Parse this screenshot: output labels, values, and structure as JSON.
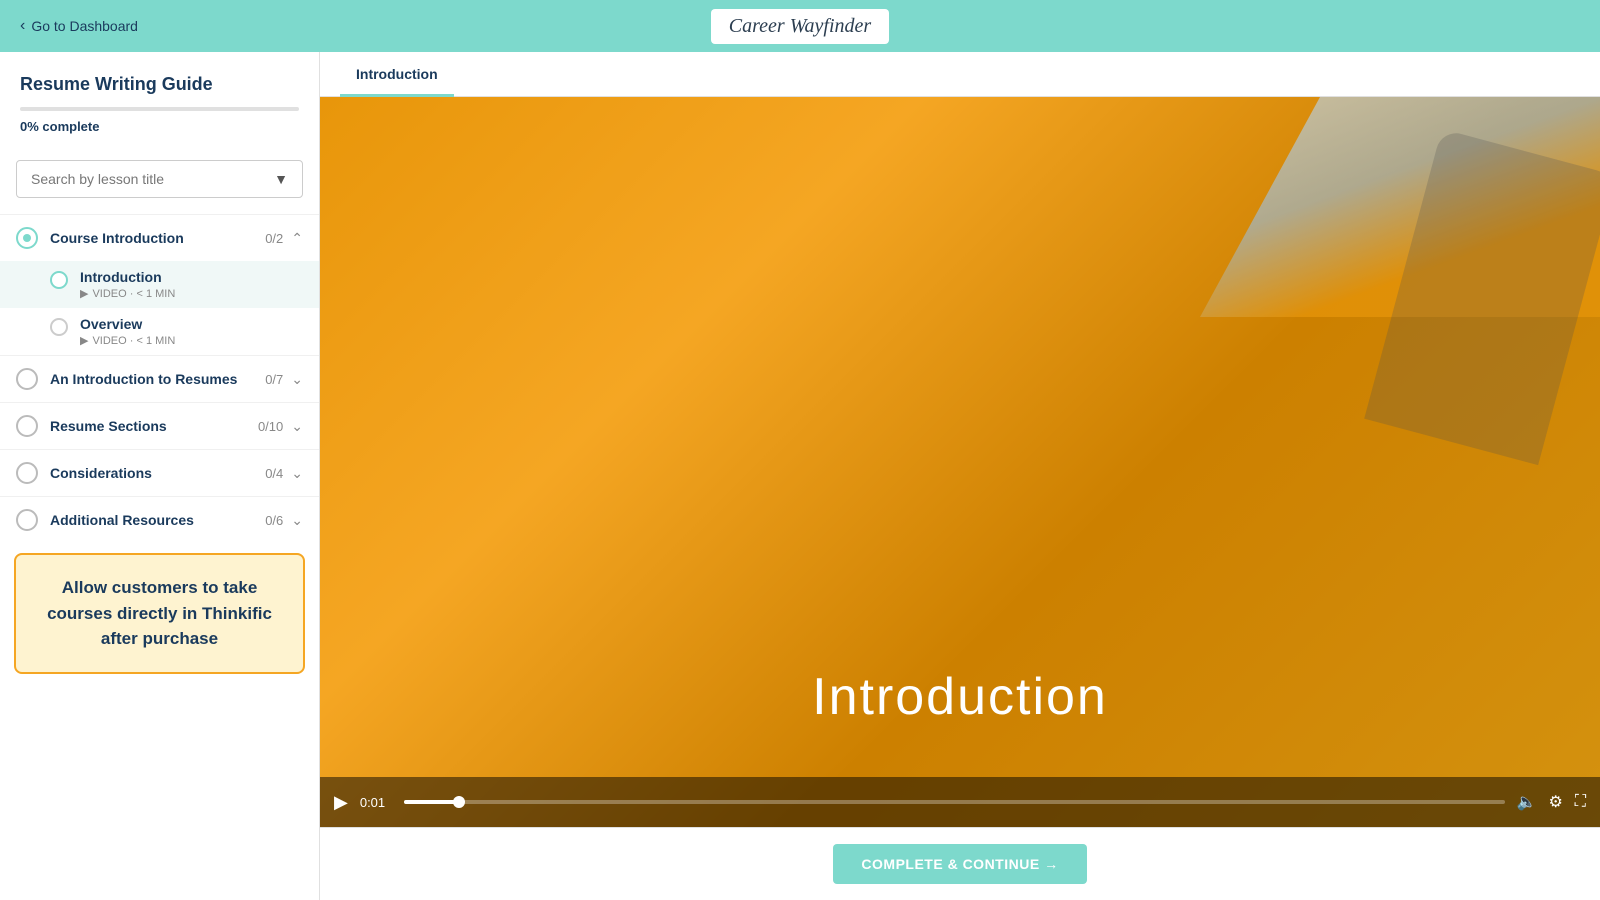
{
  "header": {
    "back_label": "Go to Dashboard",
    "brand_name": "Career Wayfinder"
  },
  "sidebar": {
    "course_title": "Resume Writing Guide",
    "progress_percent": 0,
    "progress_label": "0% complete",
    "search_placeholder": "Search by lesson title",
    "sections": [
      {
        "id": "course-intro",
        "name": "Course Introduction",
        "count": "0/2",
        "expanded": true,
        "circle_state": "active",
        "lessons": [
          {
            "id": "intro",
            "title": "Introduction",
            "meta": "VIDEO · < 1 MIN",
            "state": "current",
            "active": true
          },
          {
            "id": "overview",
            "title": "Overview",
            "meta": "VIDEO · < 1 MIN",
            "state": "empty",
            "active": false
          }
        ]
      },
      {
        "id": "intro-resumes",
        "name": "An Introduction to Resumes",
        "count": "0/7",
        "expanded": false,
        "circle_state": "empty",
        "lessons": []
      },
      {
        "id": "resume-sections",
        "name": "Resume Sections",
        "count": "0/10",
        "expanded": false,
        "circle_state": "empty",
        "lessons": []
      },
      {
        "id": "considerations",
        "name": "Considerations",
        "count": "0/4",
        "expanded": false,
        "circle_state": "empty",
        "lessons": []
      },
      {
        "id": "additional-resources",
        "name": "Additional Resources",
        "count": "0/6",
        "expanded": false,
        "circle_state": "empty",
        "lessons": []
      }
    ],
    "callout_text": "Allow customers to take courses directly in Thinkific after purchase"
  },
  "content": {
    "active_tab": "Introduction",
    "tabs": [
      "Introduction"
    ],
    "video": {
      "title_overlay": "Introduction",
      "time_current": "0:01",
      "progress_percent": 5
    },
    "complete_button_label": "COMPLETE & CONTINUE →"
  }
}
